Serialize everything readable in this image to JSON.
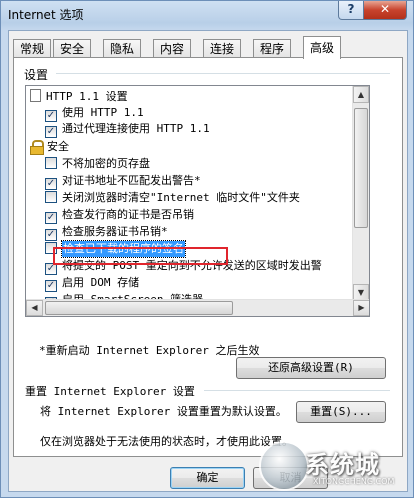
{
  "window": {
    "title": "Internet 选项",
    "help_glyph": "?",
    "close_glyph": "✕"
  },
  "tabs": [
    {
      "label": "常规",
      "active": false
    },
    {
      "label": "安全",
      "active": false
    },
    {
      "label": "隐私",
      "active": false
    },
    {
      "label": "内容",
      "active": false
    },
    {
      "label": "连接",
      "active": false
    },
    {
      "label": "程序",
      "active": false
    },
    {
      "label": "高级",
      "active": true
    }
  ],
  "settings": {
    "group_label": "设置",
    "items": [
      {
        "type": "category",
        "icon": "folder-icon",
        "label": "HTTP 1.1 设置"
      },
      {
        "type": "checkbox",
        "checked": true,
        "label": "使用 HTTP 1.1"
      },
      {
        "type": "checkbox",
        "checked": true,
        "label": "通过代理连接使用 HTTP 1.1"
      },
      {
        "type": "category",
        "icon": "lock-icon",
        "label": "安全"
      },
      {
        "type": "checkbox",
        "checked": false,
        "label": "不将加密的页存盘"
      },
      {
        "type": "checkbox",
        "checked": true,
        "label": "对证书地址不匹配发出警告*"
      },
      {
        "type": "checkbox",
        "checked": false,
        "label": "关闭浏览器时清空\"Internet 临时文件\"文件夹"
      },
      {
        "type": "checkbox",
        "checked": true,
        "label": "检查发行商的证书是否吊销"
      },
      {
        "type": "checkbox",
        "checked": true,
        "label": "检查服务器证书吊销*"
      },
      {
        "type": "checkbox",
        "checked": false,
        "label": "检查已下载的程序的签名",
        "highlighted": true
      },
      {
        "type": "checkbox",
        "checked": true,
        "label": "将提交的 POST 重定向到不允许发送的区域时发出警"
      },
      {
        "type": "checkbox",
        "checked": true,
        "label": "启用 DOM 存储"
      },
      {
        "type": "checkbox",
        "checked": true,
        "label": "启用 SmartScreen 筛选器"
      }
    ],
    "restart_note": "*重新启动 Internet Explorer 之后生效",
    "restore_button": "还原高级设置(R)"
  },
  "reset": {
    "title": "重置 Internet Explorer 设置",
    "description": "将 Internet Explorer 设置重置为默认设置。",
    "button": "重置(S)...",
    "warning": "仅在浏览器处于无法使用的状态时，才使用此设置。"
  },
  "footer": {
    "ok_button": "确定",
    "cancel_button": "取消"
  },
  "watermark": {
    "text": "系统城",
    "url": "XITONGCHENG.COM"
  },
  "colors": {
    "highlight": "#3399ff",
    "annotation_box": "#e0252d"
  }
}
